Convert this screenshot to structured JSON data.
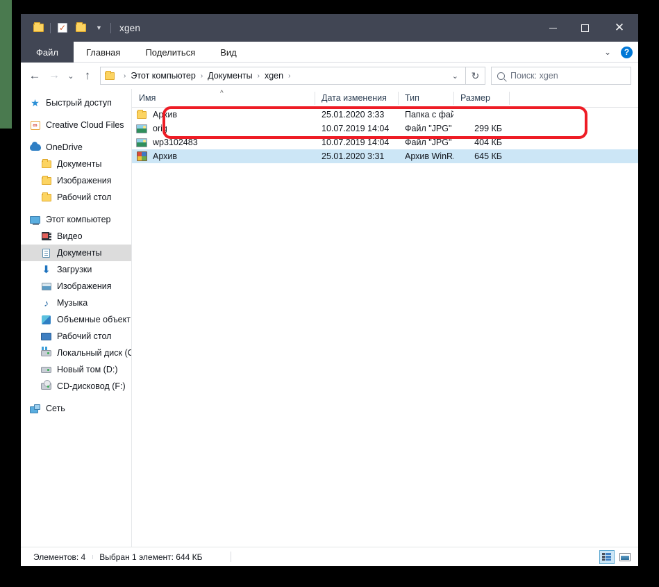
{
  "window": {
    "title": "xgen",
    "quick_access": {
      "folder_icon": "folder-icon",
      "properties_icon": "checkbox-icon",
      "new_folder_icon": "new-folder-icon",
      "customize_caret": "chevron-down-icon"
    },
    "controls": {
      "minimize": "minimize-icon",
      "maximize": "maximize-icon",
      "close": "close-icon"
    }
  },
  "ribbon": {
    "tabs": [
      {
        "label": "Файл",
        "active": true
      },
      {
        "label": "Главная",
        "active": false
      },
      {
        "label": "Поделиться",
        "active": false
      },
      {
        "label": "Вид",
        "active": false
      }
    ],
    "collapse_icon": "chevron-down-icon",
    "help_label": "?"
  },
  "address_bar": {
    "back_icon": "arrow-left-icon",
    "forward_icon": "arrow-right-icon",
    "recent_icon": "chevron-down-icon",
    "up_icon": "arrow-up-icon",
    "folder_icon": "folder-icon",
    "breadcrumbs": [
      "Этот компьютер",
      "Документы",
      "xgen"
    ],
    "breadcrumb_separator": "›",
    "dropdown_icon": "chevron-down-icon",
    "refresh_icon": "refresh-icon",
    "search": {
      "icon": "search-icon",
      "placeholder": "Поиск: xgen",
      "value": ""
    }
  },
  "sidebar": {
    "items": [
      {
        "label": "Быстрый доступ",
        "icon": "pin-star-icon",
        "indent": false,
        "selected": false
      },
      {
        "label": "Creative Cloud Files",
        "icon": "creative-cloud-icon",
        "indent": false,
        "selected": false
      },
      {
        "label": "OneDrive",
        "icon": "cloud-icon",
        "indent": false,
        "selected": false
      },
      {
        "label": "Документы",
        "icon": "folder-icon",
        "indent": true,
        "selected": false
      },
      {
        "label": "Изображения",
        "icon": "folder-icon",
        "indent": true,
        "selected": false
      },
      {
        "label": "Рабочий стол",
        "icon": "folder-icon",
        "indent": true,
        "selected": false
      },
      {
        "label": "Этот компьютер",
        "icon": "this-pc-icon",
        "indent": false,
        "selected": false
      },
      {
        "label": "Видео",
        "icon": "video-icon",
        "indent": true,
        "selected": false
      },
      {
        "label": "Документы",
        "icon": "documents-icon",
        "indent": true,
        "selected": true
      },
      {
        "label": "Загрузки",
        "icon": "downloads-icon",
        "indent": true,
        "selected": false
      },
      {
        "label": "Изображения",
        "icon": "pictures-icon",
        "indent": true,
        "selected": false
      },
      {
        "label": "Музыка",
        "icon": "music-icon",
        "indent": true,
        "selected": false
      },
      {
        "label": "Объемные объект",
        "icon": "3d-objects-icon",
        "indent": true,
        "selected": false
      },
      {
        "label": "Рабочий стол",
        "icon": "desktop-icon",
        "indent": true,
        "selected": false
      },
      {
        "label": "Локальный диск (С",
        "icon": "local-disk-icon",
        "indent": true,
        "selected": false
      },
      {
        "label": "Новый том (D:)",
        "icon": "drive-icon",
        "indent": true,
        "selected": false
      },
      {
        "label": "CD-дисковод (F:)",
        "icon": "cd-drive-icon",
        "indent": true,
        "selected": false
      },
      {
        "label": "Сеть",
        "icon": "network-icon",
        "indent": false,
        "selected": false
      }
    ]
  },
  "file_list": {
    "columns": [
      {
        "key": "name",
        "label": "Имя",
        "sorted": "asc"
      },
      {
        "key": "date",
        "label": "Дата изменения",
        "sorted": ""
      },
      {
        "key": "type",
        "label": "Тип",
        "sorted": ""
      },
      {
        "key": "size",
        "label": "Размер",
        "sorted": ""
      }
    ],
    "sort_indicator": "^",
    "rows": [
      {
        "name": "Архив",
        "date": "25.01.2020 3:33",
        "type": "Папка с файлами",
        "size": "",
        "icon": "folder-icon",
        "selected": false
      },
      {
        "name": "orig",
        "date": "10.07.2019 14:04",
        "type": "Файл \"JPG\"",
        "size": "299 КБ",
        "icon": "jpg-file-icon",
        "selected": false
      },
      {
        "name": "wp3102483",
        "date": "10.07.2019 14:04",
        "type": "Файл \"JPG\"",
        "size": "404 КБ",
        "icon": "jpg-file-icon",
        "selected": false
      },
      {
        "name": "Архив",
        "date": "25.01.2020 3:31",
        "type": "Архив WinRAR",
        "size": "645 КБ",
        "icon": "winrar-archive-icon",
        "selected": true
      }
    ]
  },
  "annotation": {
    "color": "#ee1c25",
    "shape": "rounded-rectangle",
    "highlights": [
      "orig",
      "wp3102483"
    ]
  },
  "status_bar": {
    "items_count": "Элементов: 4",
    "selection": "Выбран 1 элемент: 644 КБ",
    "view_buttons": [
      {
        "name": "details-view",
        "icon": "details-view-icon",
        "active": true
      },
      {
        "name": "large-icons-view",
        "icon": "large-icons-view-icon",
        "active": false
      }
    ]
  }
}
